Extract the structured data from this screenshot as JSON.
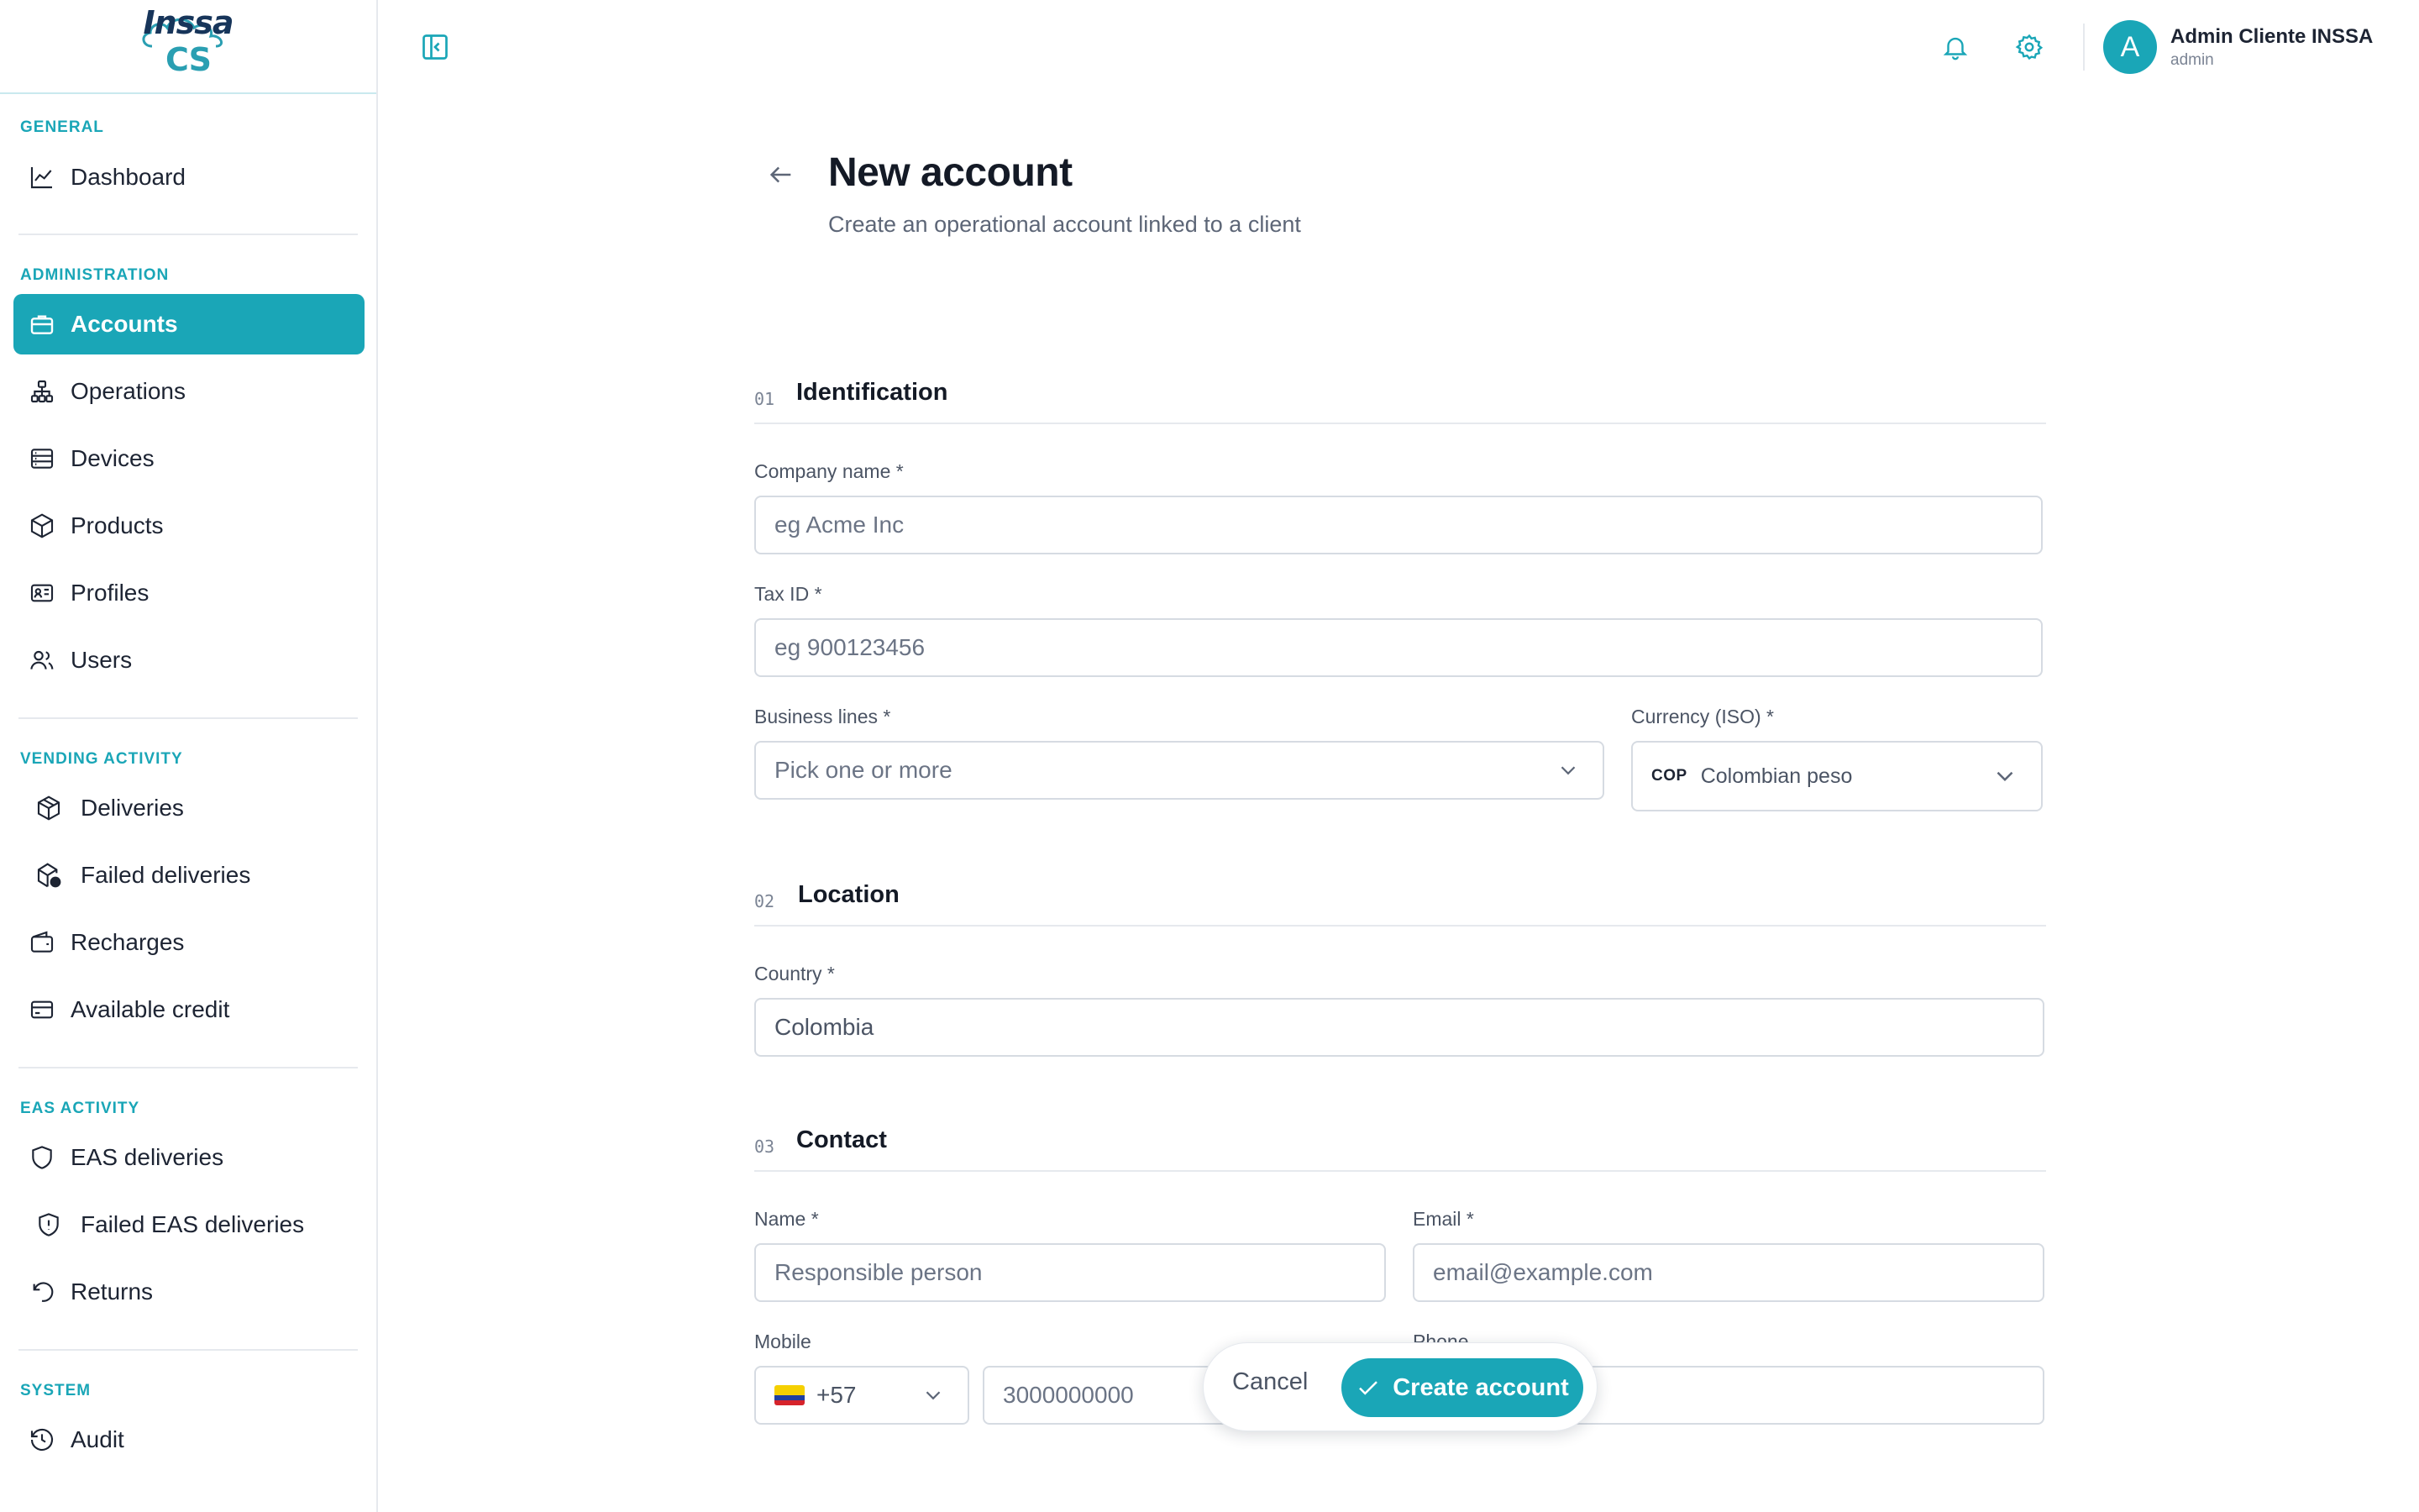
{
  "brand": {
    "logo_text_primary": "Inssa",
    "logo_text_secondary": "CS",
    "accent": "#1aa6b7"
  },
  "sidebar": {
    "sections": [
      {
        "title": "GENERAL",
        "items": [
          {
            "label": "Dashboard",
            "icon": "chart-line-icon"
          }
        ]
      },
      {
        "title": "ADMINISTRATION",
        "items": [
          {
            "label": "Accounts",
            "icon": "briefcase-icon",
            "active": true
          },
          {
            "label": "Operations",
            "icon": "hierarchy-icon"
          },
          {
            "label": "Devices",
            "icon": "server-icon"
          },
          {
            "label": "Products",
            "icon": "box-icon"
          },
          {
            "label": "Profiles",
            "icon": "id-card-icon"
          },
          {
            "label": "Users",
            "icon": "users-icon"
          }
        ]
      },
      {
        "title": "VENDING ACTIVITY",
        "items": [
          {
            "label": "Deliveries",
            "icon": "package-icon"
          },
          {
            "label": "Failed deliveries",
            "icon": "package-alert-icon"
          },
          {
            "label": "Recharges",
            "icon": "wallet-icon"
          },
          {
            "label": "Available credit",
            "icon": "credit-card-icon"
          }
        ]
      },
      {
        "title": "EAS ACTIVITY",
        "items": [
          {
            "label": "EAS deliveries",
            "icon": "shield-icon"
          },
          {
            "label": "Failed EAS deliveries",
            "icon": "shield-alert-icon"
          },
          {
            "label": "Returns",
            "icon": "undo-icon"
          }
        ]
      },
      {
        "title": "SYSTEM",
        "items": [
          {
            "label": "Audit",
            "icon": "history-icon"
          }
        ]
      }
    ]
  },
  "topbar": {
    "user": {
      "initial": "A",
      "name": "Admin Cliente INSSA",
      "role": "admin"
    }
  },
  "header": {
    "title": "New account",
    "subtitle": "Create an operational account linked to a client"
  },
  "form": {
    "identification": {
      "num": "01",
      "title": "Identification",
      "company_label": "Company name *",
      "company_placeholder": "eg Acme Inc",
      "tax_label": "Tax ID *",
      "tax_placeholder": "eg 900123456",
      "business_label": "Business lines *",
      "business_placeholder": "Pick one or more",
      "currency_label": "Currency (ISO) *",
      "currency_code": "COP",
      "currency_name": "Colombian peso"
    },
    "location": {
      "num": "02",
      "title": "Location",
      "country_label": "Country *",
      "country_value": "Colombia"
    },
    "contact": {
      "num": "03",
      "title": "Contact",
      "name_label": "Name *",
      "name_placeholder": "Responsible person",
      "email_label": "Email *",
      "email_placeholder": "email@example.com",
      "mobile_label": "Mobile",
      "dial_code": "+57",
      "mobile_placeholder": "3000000000",
      "phone_label": "Phone"
    }
  },
  "actions": {
    "cancel": "Cancel",
    "create": "Create account"
  }
}
